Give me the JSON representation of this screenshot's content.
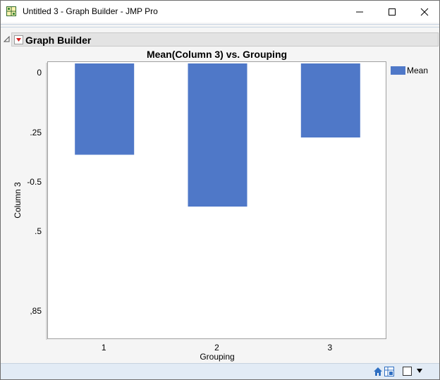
{
  "window": {
    "title": "Untitled 3 - Graph Builder - JMP Pro",
    "minimize_glyph": "—",
    "maximize_glyph": "☐",
    "close_glyph": "✕"
  },
  "report": {
    "outline_title": "Graph Builder"
  },
  "colors": {
    "bar": "#4f78c8",
    "plot_background": "#ffffff",
    "window_background": "#f5f5f5",
    "status_bar": "#e2ebf5"
  },
  "icons": {
    "app": "jmp-grid-icon",
    "hot_button": "red-triangle-icon",
    "disclosure": "disclosure-triangle-icon",
    "home": "home-icon",
    "table": "table-icon",
    "box": "checkbox-icon",
    "menu": "dropdown-arrow-icon"
  },
  "chart_data": {
    "type": "bar",
    "title": "Mean(Column 3) vs. Grouping",
    "xlabel": "Grouping",
    "ylabel": "Column 3",
    "categories": [
      "1",
      "2",
      "3"
    ],
    "series": [
      {
        "name": "Mean",
        "values": [
          -0.37,
          -0.58,
          -0.3
        ]
      }
    ],
    "ytick_labels": [
      "0",
      ".25",
      "-0.5",
      ".5",
      ",85"
    ],
    "ytick_values": [
      0,
      -0.25,
      -0.5,
      -0.75,
      -1.0
    ],
    "ylim": [
      -1.1,
      0.0
    ],
    "legend_position": "right",
    "grid": false
  }
}
